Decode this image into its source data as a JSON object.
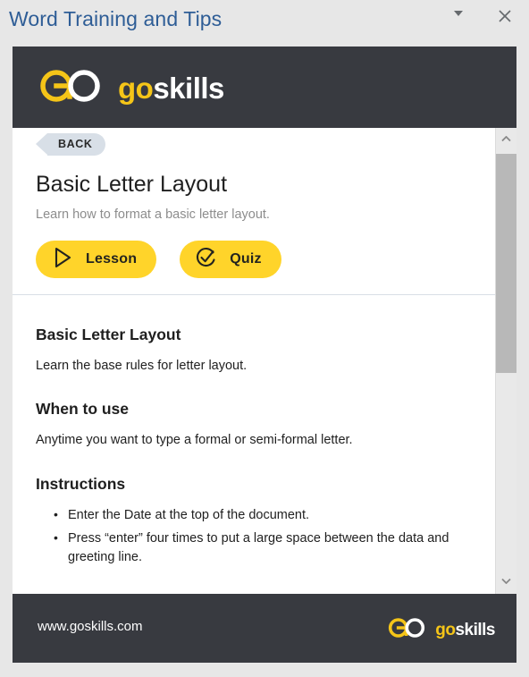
{
  "titlebar": {
    "title": "Word Training and Tips",
    "dropdown_icon": "chevron-down-icon",
    "close_icon": "close-icon"
  },
  "brand": {
    "logo_icon": "goskills-infinity-logo",
    "word_go": "go",
    "word_skills": "skills",
    "color_yellow": "#f5c518",
    "color_white": "#ffffff",
    "bar_color": "#383a40"
  },
  "lesson_header": {
    "back_label": "BACK",
    "title": "Basic Letter Layout",
    "subtitle": "Learn how to format a basic letter layout.",
    "buttons": [
      {
        "label": "Lesson",
        "icon": "play-circle-icon"
      },
      {
        "label": "Quiz",
        "icon": "check-circle-icon"
      }
    ],
    "button_color": "#ffd42a"
  },
  "article": {
    "sections": [
      {
        "heading": "Basic Letter Layout",
        "paragraph": "Learn the base rules for letter layout."
      },
      {
        "heading": "When to use",
        "paragraph": "Anytime you want to type a formal or semi-formal letter."
      }
    ],
    "instructions_heading": "Instructions",
    "instructions": [
      "Enter the Date at the top of the document.",
      "Press “enter” four times to put a large space between the data and greeting line."
    ]
  },
  "scrollbar": {
    "up_icon": "chevron-up-icon",
    "down_icon": "chevron-down-icon"
  },
  "footer": {
    "url": "www.goskills.com",
    "logo_icon": "goskills-infinity-logo",
    "word_go": "go",
    "word_skills": "skills"
  }
}
